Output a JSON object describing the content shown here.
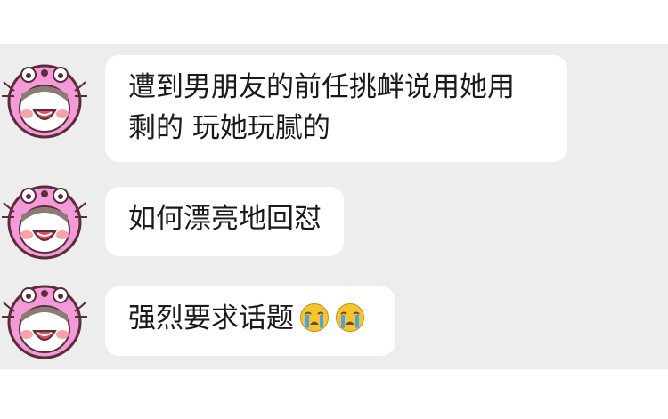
{
  "chat": {
    "messages": [
      {
        "lines": [
          "遭到男朋友的前任挑衅说用她用",
          "剩的 玩她玩腻的"
        ],
        "emojis": []
      },
      {
        "lines": [
          "如何漂亮地回怼"
        ],
        "emojis": []
      },
      {
        "lines": [
          "强烈要求话题"
        ],
        "emojis": [
          "crying-face-icon",
          "crying-face-icon"
        ]
      }
    ]
  },
  "colors": {
    "background": "#ffffff",
    "chat_background": "#ededed",
    "bubble": "#ffffff",
    "text": "#1a1a1a",
    "avatar_pink": "#f49ad8",
    "emoji_yellow": "#f5c431",
    "emoji_tears": "#4aa3e8"
  }
}
